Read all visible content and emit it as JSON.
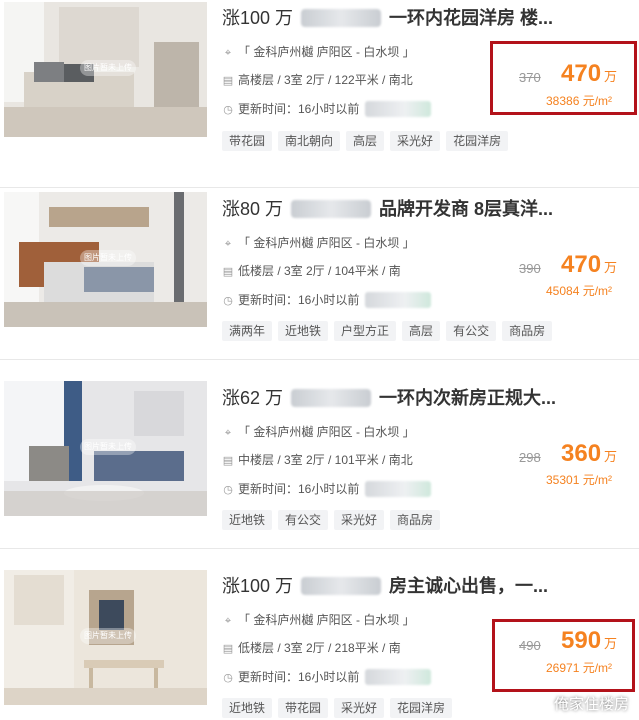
{
  "listings": [
    {
      "rise": "涨100 万",
      "headline": "一环内花园洋房 楼...",
      "location": "「 金科庐州樾 庐阳区 - 白水坝 」",
      "details": "高楼层 / 3室 2厅 / 122平米 / 南北",
      "updated": "更新时间：16小时以前",
      "old_price": "370",
      "price": "470",
      "price_unit": "万",
      "unit_price": "38386 元/m²",
      "tags": [
        "带花园",
        "南北朝向",
        "高层",
        "采光好",
        "花园洋房"
      ],
      "thumb_label": "图片暂未上传"
    },
    {
      "rise": "涨80 万",
      "headline": "品牌开发商 8层真洋...",
      "location": "「 金科庐州樾 庐阳区 - 白水坝 」",
      "details": "低楼层 / 3室 2厅 / 104平米 / 南",
      "updated": "更新时间：16小时以前",
      "old_price": "390",
      "price": "470",
      "price_unit": "万",
      "unit_price": "45084 元/m²",
      "tags": [
        "满两年",
        "近地铁",
        "户型方正",
        "高层",
        "有公交",
        "商品房"
      ],
      "thumb_label": "图片暂未上传"
    },
    {
      "rise": "涨62 万",
      "headline": "一环内次新房正规大...",
      "location": "「 金科庐州樾 庐阳区 - 白水坝 」",
      "details": "中楼层 / 3室 2厅 / 101平米 / 南北",
      "updated": "更新时间：16小时以前",
      "old_price": "298",
      "price": "360",
      "price_unit": "万",
      "unit_price": "35301 元/m²",
      "tags": [
        "近地铁",
        "有公交",
        "采光好",
        "商品房"
      ],
      "thumb_label": "图片暂未上传"
    },
    {
      "rise": "涨100 万",
      "headline": "房主诚心出售，一...",
      "location": "「 金科庐州樾 庐阳区 - 白水坝 」",
      "details": "低楼层 / 3室 2厅 / 218平米 / 南",
      "updated": "更新时间：16小时以前",
      "old_price": "490",
      "price": "590",
      "price_unit": "万",
      "unit_price": "26971 元/m²",
      "tags": [
        "近地铁",
        "带花园",
        "采光好",
        "花园洋房"
      ],
      "thumb_label": "图片暂未上传"
    }
  ],
  "watermark": "俺家住楼房",
  "colors": {
    "price": "#f58220",
    "highlight_border": "#b3121a"
  },
  "icons": {
    "location": "location-pin-icon",
    "layout": "floor-plan-icon",
    "time": "clock-icon"
  }
}
